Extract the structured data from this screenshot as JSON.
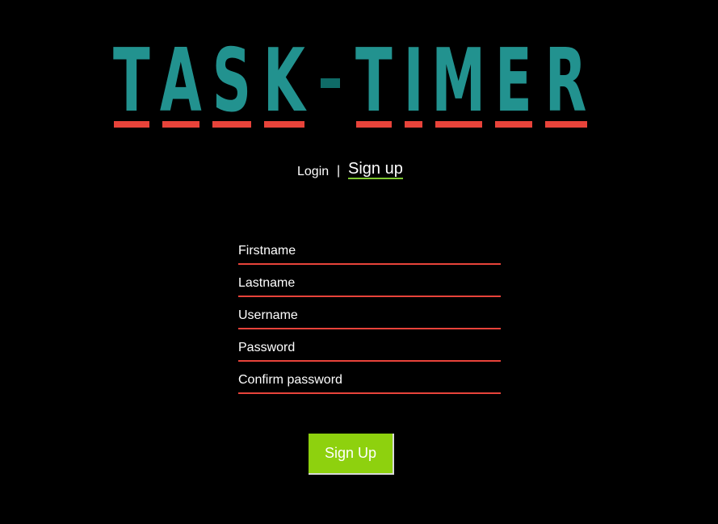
{
  "logo": {
    "letters": [
      "T",
      "A",
      "S",
      "K",
      "T",
      "I",
      "M",
      "E",
      "R"
    ],
    "colors": {
      "text": "#22928f",
      "underline": "#e8433a",
      "dash": "#0f6b67"
    }
  },
  "nav": {
    "login_label": "Login",
    "separator": "|",
    "signup_label": "Sign up"
  },
  "form": {
    "fields": [
      {
        "placeholder": "Firstname",
        "value": ""
      },
      {
        "placeholder": "Lastname",
        "value": ""
      },
      {
        "placeholder": "Username",
        "value": ""
      },
      {
        "placeholder": "Password",
        "value": ""
      },
      {
        "placeholder": "Confirm password",
        "value": ""
      }
    ],
    "submit_label": "Sign Up"
  },
  "colors": {
    "background": "#000000",
    "accent_red": "#e8433a",
    "button_green": "#8ed10e",
    "link_underline": "#7ec832"
  }
}
